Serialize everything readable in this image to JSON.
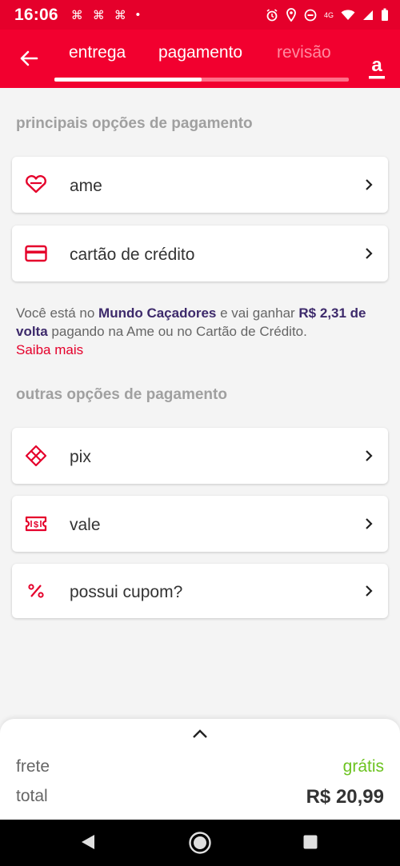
{
  "status_bar": {
    "time": "16:06",
    "network": "4G"
  },
  "header": {
    "tabs": [
      {
        "label": "entrega",
        "state": "done"
      },
      {
        "label": "pagamento",
        "state": "active"
      },
      {
        "label": "revisão",
        "state": "pending"
      }
    ],
    "progress": 0.5,
    "brand_letter": "a",
    "colors": {
      "primary": "#f2002f",
      "inactive_tab": "#ff8aa0"
    }
  },
  "main_options": {
    "title": "principais opções de pagamento",
    "items": [
      {
        "label": "ame",
        "icon": "heart-icon"
      },
      {
        "label": "cartão de crédito",
        "icon": "credit-card-icon"
      }
    ]
  },
  "cashback_info": {
    "prefix": "Você está no ",
    "program": "Mundo Caçadores",
    "middle": " e vai ganhar ",
    "amount": "R$ 2,31 de volta",
    "suffix": " pagando na Ame ou no Cartão de Crédito.",
    "link": "Saiba mais"
  },
  "other_options": {
    "title": "outras opções de pagamento",
    "items": [
      {
        "label": "pix",
        "icon": "pix-icon"
      },
      {
        "label": "vale",
        "icon": "voucher-icon"
      },
      {
        "label": "possui cupom?",
        "icon": "percent-icon"
      }
    ]
  },
  "summary": {
    "frete_label": "frete",
    "frete_value": "grátis",
    "total_label": "total",
    "total_value": "R$ 20,99",
    "colors": {
      "free": "#6cc320"
    }
  }
}
